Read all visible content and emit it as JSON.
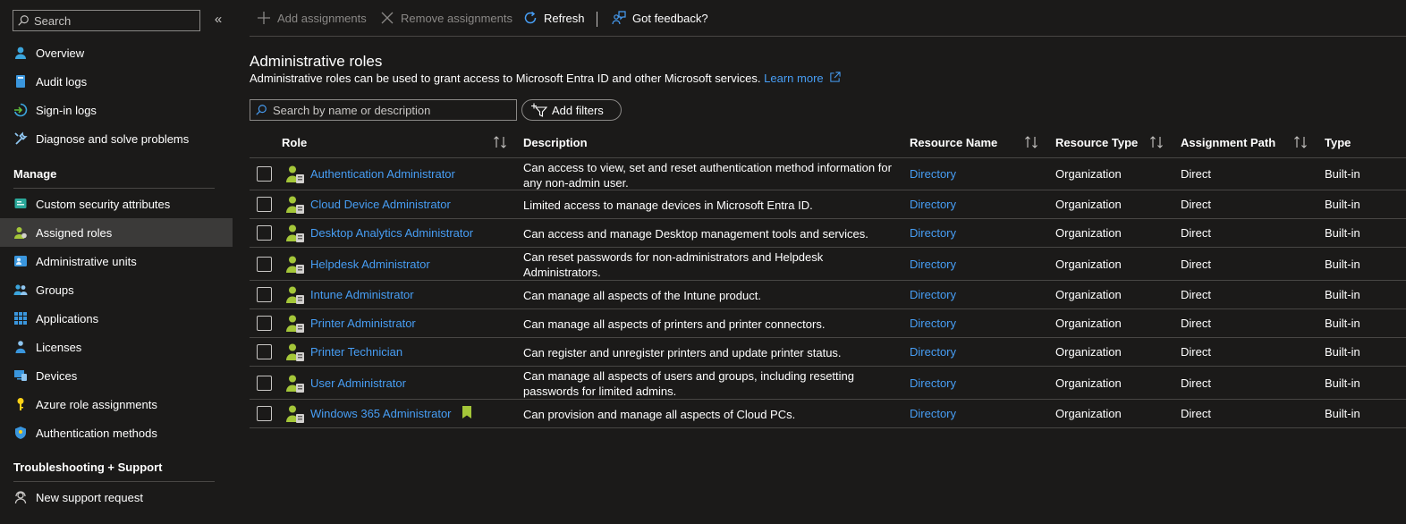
{
  "sidebar": {
    "search_placeholder": "Search",
    "collapse_label": "«",
    "top_items": [
      {
        "label": "Overview",
        "icon": "person-info-icon"
      },
      {
        "label": "Audit logs",
        "icon": "book-icon"
      },
      {
        "label": "Sign-in logs",
        "icon": "sign-in-icon"
      },
      {
        "label": "Diagnose and solve problems",
        "icon": "wrench-icon"
      }
    ],
    "manage_title": "Manage",
    "manage_items": [
      {
        "label": "Custom security attributes",
        "icon": "attributes-icon"
      },
      {
        "label": "Assigned roles",
        "icon": "assigned-roles-icon",
        "active": true
      },
      {
        "label": "Administrative units",
        "icon": "admin-units-icon"
      },
      {
        "label": "Groups",
        "icon": "groups-icon"
      },
      {
        "label": "Applications",
        "icon": "grid-icon"
      },
      {
        "label": "Licenses",
        "icon": "licenses-icon"
      },
      {
        "label": "Devices",
        "icon": "devices-icon"
      },
      {
        "label": "Azure role assignments",
        "icon": "key-icon"
      },
      {
        "label": "Authentication methods",
        "icon": "shield-icon"
      }
    ],
    "support_title": "Troubleshooting + Support",
    "support_items": [
      {
        "label": "New support request",
        "icon": "support-person-icon"
      }
    ]
  },
  "toolbar": {
    "add": "Add assignments",
    "remove": "Remove assignments",
    "refresh": "Refresh",
    "feedback": "Got feedback?"
  },
  "page": {
    "title": "Administrative roles",
    "description": "Administrative roles can be used to grant access to Microsoft Entra ID and other Microsoft services.",
    "learn_more": "Learn more",
    "search_placeholder": "Search by name or description",
    "add_filters": "Add filters"
  },
  "table": {
    "columns": {
      "role": "Role",
      "description": "Description",
      "resource_name": "Resource Name",
      "resource_type": "Resource Type",
      "assignment_path": "Assignment Path",
      "type": "Type"
    },
    "rows": [
      {
        "role": "Authentication Administrator",
        "description": "Can access to view, set and reset authentication method information for any non-admin user.",
        "resource_name": "Directory",
        "resource_type": "Organization",
        "assignment_path": "Direct",
        "type": "Built-in"
      },
      {
        "role": "Cloud Device Administrator",
        "description": "Limited access to manage devices in Microsoft Entra ID.",
        "resource_name": "Directory",
        "resource_type": "Organization",
        "assignment_path": "Direct",
        "type": "Built-in"
      },
      {
        "role": "Desktop Analytics Administrator",
        "description": "Can access and manage Desktop management tools and services.",
        "resource_name": "Directory",
        "resource_type": "Organization",
        "assignment_path": "Direct",
        "type": "Built-in"
      },
      {
        "role": "Helpdesk Administrator",
        "description": "Can reset passwords for non-administrators and Helpdesk Administrators.",
        "resource_name": "Directory",
        "resource_type": "Organization",
        "assignment_path": "Direct",
        "type": "Built-in"
      },
      {
        "role": "Intune Administrator",
        "description": "Can manage all aspects of the Intune product.",
        "resource_name": "Directory",
        "resource_type": "Organization",
        "assignment_path": "Direct",
        "type": "Built-in"
      },
      {
        "role": "Printer Administrator",
        "description": "Can manage all aspects of printers and printer connectors.",
        "resource_name": "Directory",
        "resource_type": "Organization",
        "assignment_path": "Direct",
        "type": "Built-in"
      },
      {
        "role": "Printer Technician",
        "description": "Can register and unregister printers and update printer status.",
        "resource_name": "Directory",
        "resource_type": "Organization",
        "assignment_path": "Direct",
        "type": "Built-in"
      },
      {
        "role": "User Administrator",
        "description": "Can manage all aspects of users and groups, including resetting passwords for limited admins.",
        "resource_name": "Directory",
        "resource_type": "Organization",
        "assignment_path": "Direct",
        "type": "Built-in"
      },
      {
        "role": "Windows 365 Administrator",
        "description": "Can provision and manage all aspects of Cloud PCs.",
        "resource_name": "Directory",
        "resource_type": "Organization",
        "assignment_path": "Direct",
        "type": "Built-in",
        "bookmark": true
      }
    ]
  },
  "colors": {
    "background": "#1b1a19",
    "link": "#479ef5",
    "active_nav": "#3b3a39",
    "role_icon_green": "#a4c639",
    "border": "#484644"
  }
}
